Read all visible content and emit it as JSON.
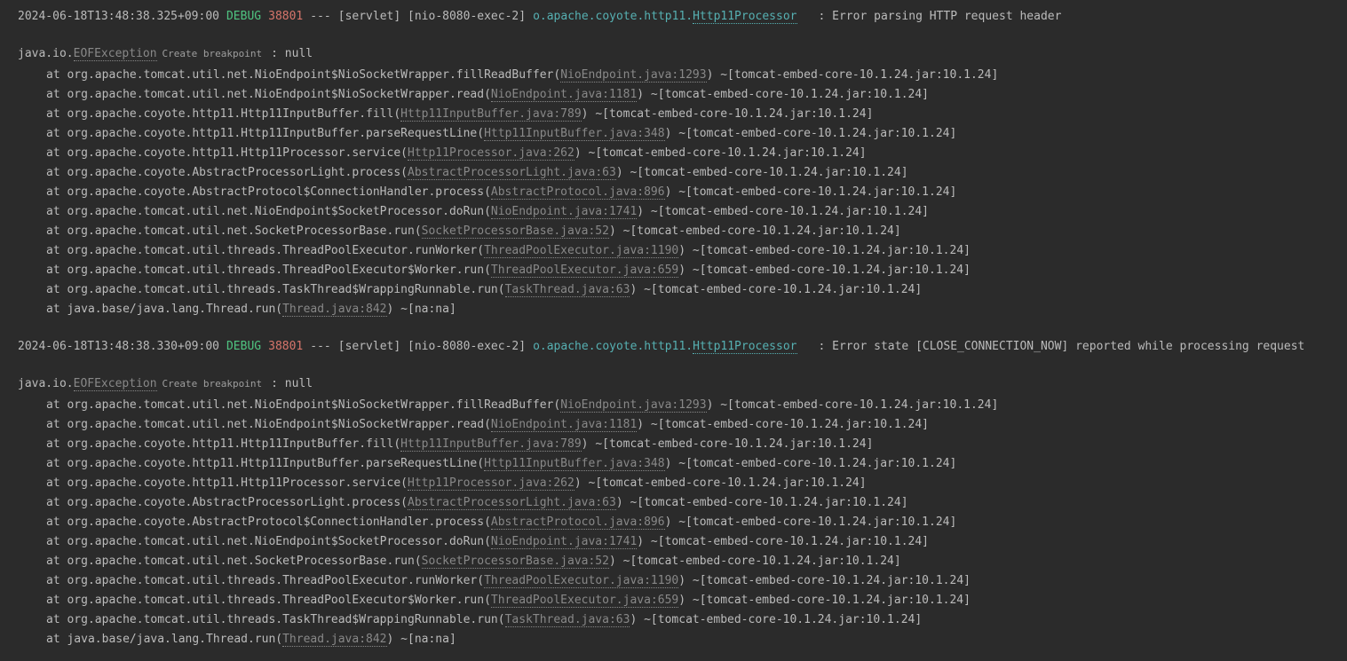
{
  "blocks": [
    {
      "ts": "2024-06-18T13:48:38.325+09:00",
      "level": "DEBUG",
      "pid": "38801",
      "dashes": "---",
      "thread": "[servlet] [nio-8080-exec-2]",
      "loggerPrefix": "o.apache.coyote.http11.",
      "loggerClass": "Http11Processor",
      "msg": ": Error parsing HTTP request header",
      "excPkg": "java.io.",
      "excClass": "EOFException",
      "breakpoint": "Create breakpoint",
      "excSuffix": ": null",
      "stack": [
        {
          "pre": "at org.apache.tomcat.util.net.NioEndpoint$NioSocketWrapper.fillReadBuffer(",
          "link": "NioEndpoint.java:1293",
          "post": ") ~[tomcat-embed-core-10.1.24.jar:10.1.24]"
        },
        {
          "pre": "at org.apache.tomcat.util.net.NioEndpoint$NioSocketWrapper.read(",
          "link": "NioEndpoint.java:1181",
          "post": ") ~[tomcat-embed-core-10.1.24.jar:10.1.24]"
        },
        {
          "pre": "at org.apache.coyote.http11.Http11InputBuffer.fill(",
          "link": "Http11InputBuffer.java:789",
          "post": ") ~[tomcat-embed-core-10.1.24.jar:10.1.24]"
        },
        {
          "pre": "at org.apache.coyote.http11.Http11InputBuffer.parseRequestLine(",
          "link": "Http11InputBuffer.java:348",
          "post": ") ~[tomcat-embed-core-10.1.24.jar:10.1.24]"
        },
        {
          "pre": "at org.apache.coyote.http11.Http11Processor.service(",
          "link": "Http11Processor.java:262",
          "post": ") ~[tomcat-embed-core-10.1.24.jar:10.1.24]"
        },
        {
          "pre": "at org.apache.coyote.AbstractProcessorLight.process(",
          "link": "AbstractProcessorLight.java:63",
          "post": ") ~[tomcat-embed-core-10.1.24.jar:10.1.24]"
        },
        {
          "pre": "at org.apache.coyote.AbstractProtocol$ConnectionHandler.process(",
          "link": "AbstractProtocol.java:896",
          "post": ") ~[tomcat-embed-core-10.1.24.jar:10.1.24]"
        },
        {
          "pre": "at org.apache.tomcat.util.net.NioEndpoint$SocketProcessor.doRun(",
          "link": "NioEndpoint.java:1741",
          "post": ") ~[tomcat-embed-core-10.1.24.jar:10.1.24]"
        },
        {
          "pre": "at org.apache.tomcat.util.net.SocketProcessorBase.run(",
          "link": "SocketProcessorBase.java:52",
          "post": ") ~[tomcat-embed-core-10.1.24.jar:10.1.24]"
        },
        {
          "pre": "at org.apache.tomcat.util.threads.ThreadPoolExecutor.runWorker(",
          "link": "ThreadPoolExecutor.java:1190",
          "post": ") ~[tomcat-embed-core-10.1.24.jar:10.1.24]"
        },
        {
          "pre": "at org.apache.tomcat.util.threads.ThreadPoolExecutor$Worker.run(",
          "link": "ThreadPoolExecutor.java:659",
          "post": ") ~[tomcat-embed-core-10.1.24.jar:10.1.24]"
        },
        {
          "pre": "at org.apache.tomcat.util.threads.TaskThread$WrappingRunnable.run(",
          "link": "TaskThread.java:63",
          "post": ") ~[tomcat-embed-core-10.1.24.jar:10.1.24]"
        },
        {
          "pre": "at java.base/java.lang.Thread.run(",
          "link": "Thread.java:842",
          "post": ") ~[na:na]"
        }
      ]
    },
    {
      "ts": "2024-06-18T13:48:38.330+09:00",
      "level": "DEBUG",
      "pid": "38801",
      "dashes": "---",
      "thread": "[servlet] [nio-8080-exec-2]",
      "loggerPrefix": "o.apache.coyote.http11.",
      "loggerClass": "Http11Processor",
      "msg": ": Error state [CLOSE_CONNECTION_NOW] reported while processing request",
      "excPkg": "java.io.",
      "excClass": "EOFException",
      "breakpoint": "Create breakpoint",
      "excSuffix": ": null",
      "stack": [
        {
          "pre": "at org.apache.tomcat.util.net.NioEndpoint$NioSocketWrapper.fillReadBuffer(",
          "link": "NioEndpoint.java:1293",
          "post": ") ~[tomcat-embed-core-10.1.24.jar:10.1.24]"
        },
        {
          "pre": "at org.apache.tomcat.util.net.NioEndpoint$NioSocketWrapper.read(",
          "link": "NioEndpoint.java:1181",
          "post": ") ~[tomcat-embed-core-10.1.24.jar:10.1.24]"
        },
        {
          "pre": "at org.apache.coyote.http11.Http11InputBuffer.fill(",
          "link": "Http11InputBuffer.java:789",
          "post": ") ~[tomcat-embed-core-10.1.24.jar:10.1.24]"
        },
        {
          "pre": "at org.apache.coyote.http11.Http11InputBuffer.parseRequestLine(",
          "link": "Http11InputBuffer.java:348",
          "post": ") ~[tomcat-embed-core-10.1.24.jar:10.1.24]"
        },
        {
          "pre": "at org.apache.coyote.http11.Http11Processor.service(",
          "link": "Http11Processor.java:262",
          "post": ") ~[tomcat-embed-core-10.1.24.jar:10.1.24]"
        },
        {
          "pre": "at org.apache.coyote.AbstractProcessorLight.process(",
          "link": "AbstractProcessorLight.java:63",
          "post": ") ~[tomcat-embed-core-10.1.24.jar:10.1.24]"
        },
        {
          "pre": "at org.apache.coyote.AbstractProtocol$ConnectionHandler.process(",
          "link": "AbstractProtocol.java:896",
          "post": ") ~[tomcat-embed-core-10.1.24.jar:10.1.24]"
        },
        {
          "pre": "at org.apache.tomcat.util.net.NioEndpoint$SocketProcessor.doRun(",
          "link": "NioEndpoint.java:1741",
          "post": ") ~[tomcat-embed-core-10.1.24.jar:10.1.24]"
        },
        {
          "pre": "at org.apache.tomcat.util.net.SocketProcessorBase.run(",
          "link": "SocketProcessorBase.java:52",
          "post": ") ~[tomcat-embed-core-10.1.24.jar:10.1.24]"
        },
        {
          "pre": "at org.apache.tomcat.util.threads.ThreadPoolExecutor.runWorker(",
          "link": "ThreadPoolExecutor.java:1190",
          "post": ") ~[tomcat-embed-core-10.1.24.jar:10.1.24]"
        },
        {
          "pre": "at org.apache.tomcat.util.threads.ThreadPoolExecutor$Worker.run(",
          "link": "ThreadPoolExecutor.java:659",
          "post": ") ~[tomcat-embed-core-10.1.24.jar:10.1.24]"
        },
        {
          "pre": "at org.apache.tomcat.util.threads.TaskThread$WrappingRunnable.run(",
          "link": "TaskThread.java:63",
          "post": ") ~[tomcat-embed-core-10.1.24.jar:10.1.24]"
        },
        {
          "pre": "at java.base/java.lang.Thread.run(",
          "link": "Thread.java:842",
          "post": ") ~[na:na]"
        }
      ]
    }
  ]
}
